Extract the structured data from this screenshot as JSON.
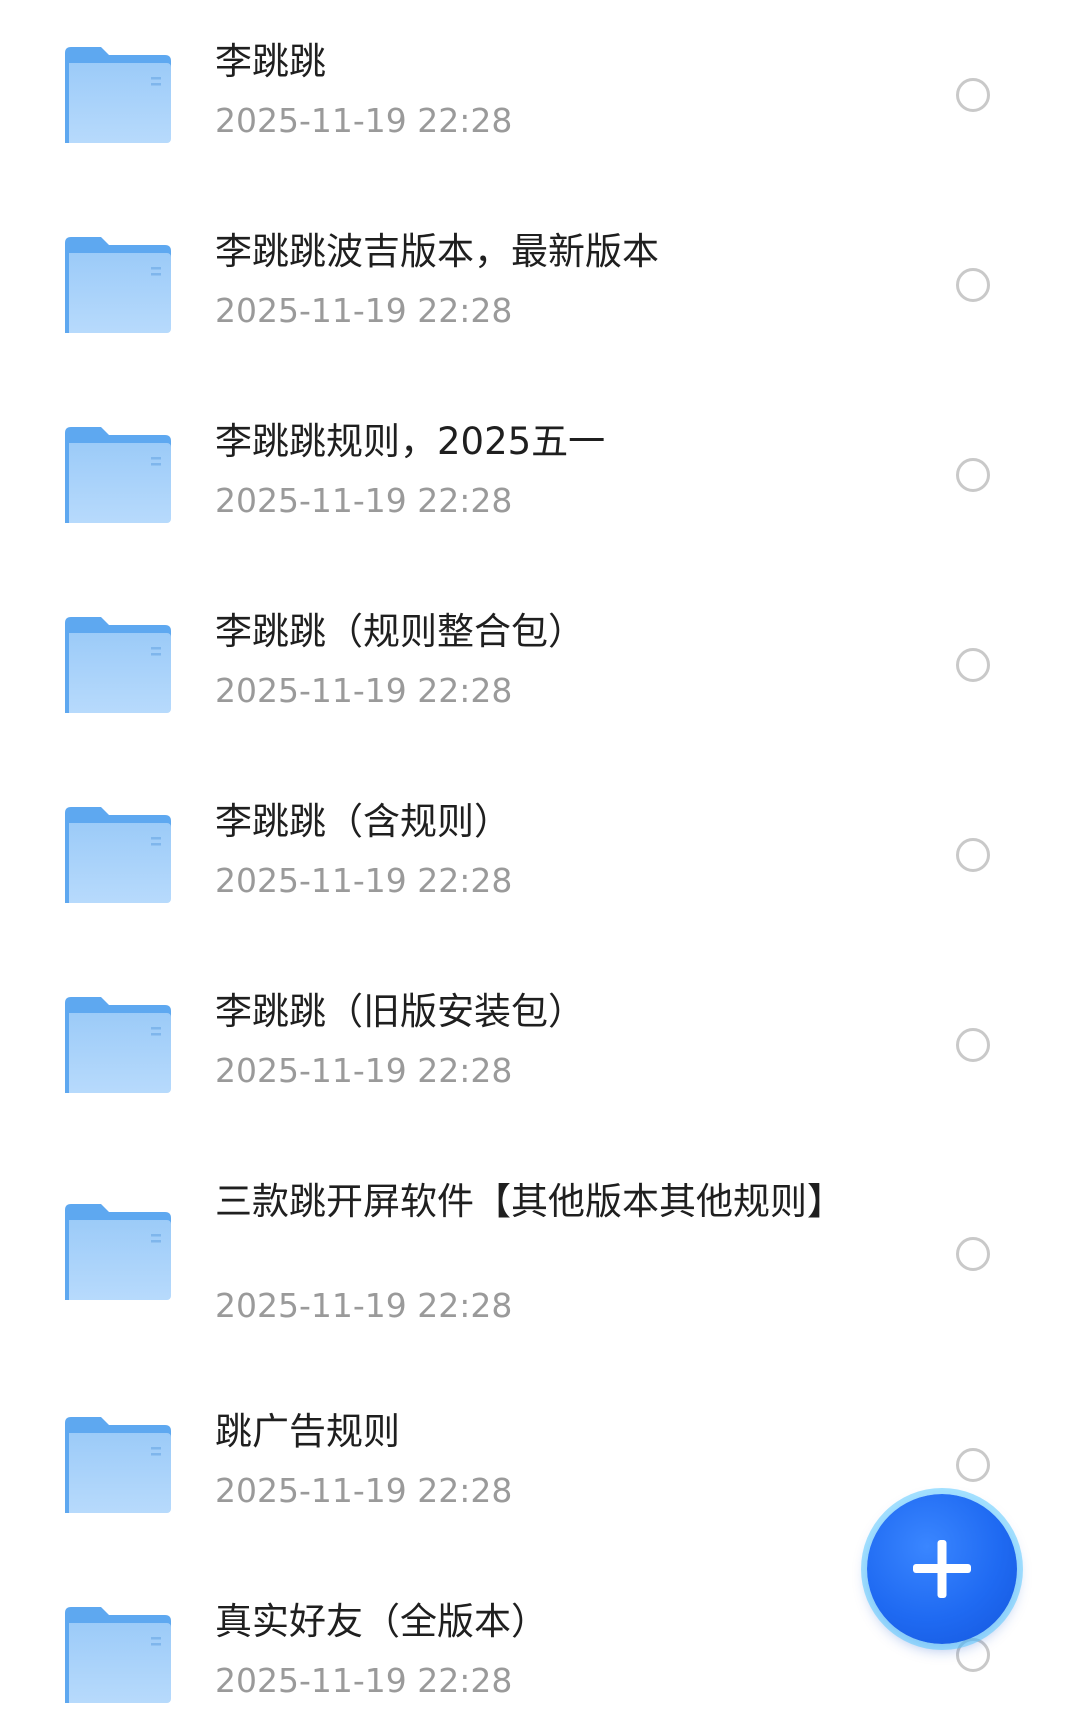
{
  "list": {
    "items": [
      {
        "name": "李跳跳",
        "date": "2025-11-19 22:28"
      },
      {
        "name": "李跳跳波吉版本，最新版本",
        "date": "2025-11-19 22:28"
      },
      {
        "name": "李跳跳规则，2025五一",
        "date": "2025-11-19 22:28"
      },
      {
        "name": "李跳跳（规则整合包）",
        "date": "2025-11-19 22:28"
      },
      {
        "name": "李跳跳（含规则）",
        "date": "2025-11-19 22:28"
      },
      {
        "name": "李跳跳（旧版安装包）",
        "date": "2025-11-19 22:28"
      },
      {
        "name": "三款跳开屏软件【其他版本其他规则】",
        "date": "2025-11-19 22:28"
      },
      {
        "name": "跳广告规则",
        "date": "2025-11-19 22:28"
      },
      {
        "name": "真实好友（全版本）",
        "date": "2025-11-19 22:28"
      }
    ]
  },
  "icons": {
    "folder": "folder-icon",
    "radio": "radio-unselected-icon",
    "fab": "plus-icon"
  },
  "colors": {
    "folder_back": "#5ea8f0",
    "folder_front": "#a9d2fb",
    "name_text": "#1f1f1f",
    "date_text": "#9a9a9a",
    "radio_border": "#c9c9c9",
    "fab_fill": "#1f6af2",
    "fab_glow": "#5ac8ff"
  }
}
